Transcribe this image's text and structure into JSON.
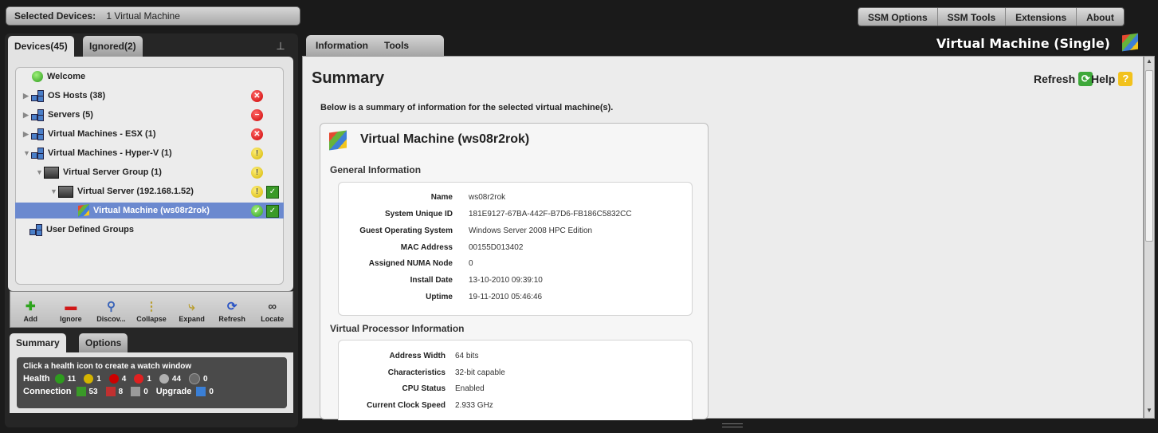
{
  "header": {
    "selected_label": "Selected Devices:",
    "selected_value": "1 Virtual Machine",
    "menu": [
      "SSM Options",
      "SSM Tools",
      "Extensions",
      "About"
    ]
  },
  "left": {
    "tabs": [
      "Devices(45)",
      "Ignored(2)"
    ],
    "tree": [
      {
        "label": "Welcome",
        "icon": "globe-icon"
      },
      {
        "label": "OS Hosts (38)",
        "icon": "network-icon",
        "health": "critical"
      },
      {
        "label": "Servers (5)",
        "icon": "network-icon",
        "health": "error"
      },
      {
        "label": "Virtual Machines - ESX (1)",
        "icon": "network-icon",
        "health": "critical"
      },
      {
        "label": "Virtual Machines - Hyper-V (1)",
        "icon": "network-icon",
        "health": "warning"
      },
      {
        "label": "Virtual Server Group (1)",
        "icon": "server-icon",
        "health": "warning"
      },
      {
        "label": "Virtual Server (192.168.1.52)",
        "icon": "server-icon",
        "health": "warning",
        "connection": "connected"
      },
      {
        "label": "Virtual Machine (ws08r2rok)",
        "icon": "windows-vm-icon",
        "health": "ok",
        "connection": "connected",
        "selected": true
      },
      {
        "label": "User Defined Groups",
        "icon": "network-icon"
      }
    ],
    "toolbar": [
      {
        "label": "Add",
        "icon": "plus-icon"
      },
      {
        "label": "Ignore",
        "icon": "minus-icon"
      },
      {
        "label": "Discov...",
        "icon": "discover-icon"
      },
      {
        "label": "Collapse",
        "icon": "collapse-icon"
      },
      {
        "label": "Expand",
        "icon": "expand-icon"
      },
      {
        "label": "Refresh",
        "icon": "refresh-icon"
      },
      {
        "label": "Locate",
        "icon": "binoculars-icon"
      }
    ],
    "bottom_tabs": [
      "Summary",
      "Options"
    ],
    "watch_hint": "Click a health icon to create a watch window",
    "health_label": "Health",
    "health_counts": [
      "11",
      "1",
      "4",
      "1",
      "44",
      "0"
    ],
    "connection_label": "Connection",
    "connection_counts": [
      "53",
      "8",
      "0"
    ],
    "upgrade_label": "Upgrade",
    "upgrade_count": "0"
  },
  "right": {
    "tabs": [
      "Information",
      "Tools"
    ],
    "heading": "Virtual Machine (Single)",
    "title": "Summary",
    "refresh": "Refresh",
    "help": "Help",
    "description": "Below is a summary of information for the selected virtual machine(s).",
    "vm_title": "Virtual Machine (ws08r2rok)",
    "general_heading": "General Information",
    "general": [
      {
        "k": "Name",
        "v": "ws08r2rok"
      },
      {
        "k": "System Unique ID",
        "v": "181E9127-67BA-442F-B7D6-FB186C5832CC"
      },
      {
        "k": "Guest Operating System",
        "v": "Windows Server 2008 HPC Edition"
      },
      {
        "k": "MAC Address",
        "v": "00155D013402"
      },
      {
        "k": "Assigned NUMA Node",
        "v": "0"
      },
      {
        "k": "Install Date",
        "v": "13-10-2010 09:39:10"
      },
      {
        "k": "Uptime",
        "v": "19-11-2010 05:46:46"
      }
    ],
    "processor_heading": "Virtual Processor Information",
    "processor": [
      {
        "k": "Address Width",
        "v": "64 bits"
      },
      {
        "k": "Characteristics",
        "v": "32-bit capable"
      },
      {
        "k": "CPU Status",
        "v": "Enabled"
      },
      {
        "k": "Current Clock Speed",
        "v": "2.933 GHz"
      }
    ]
  },
  "colors": {
    "selection": "#6b89cf",
    "ok": "#2e9c1e",
    "warning": "#d4b400",
    "critical": "#cc0000"
  }
}
